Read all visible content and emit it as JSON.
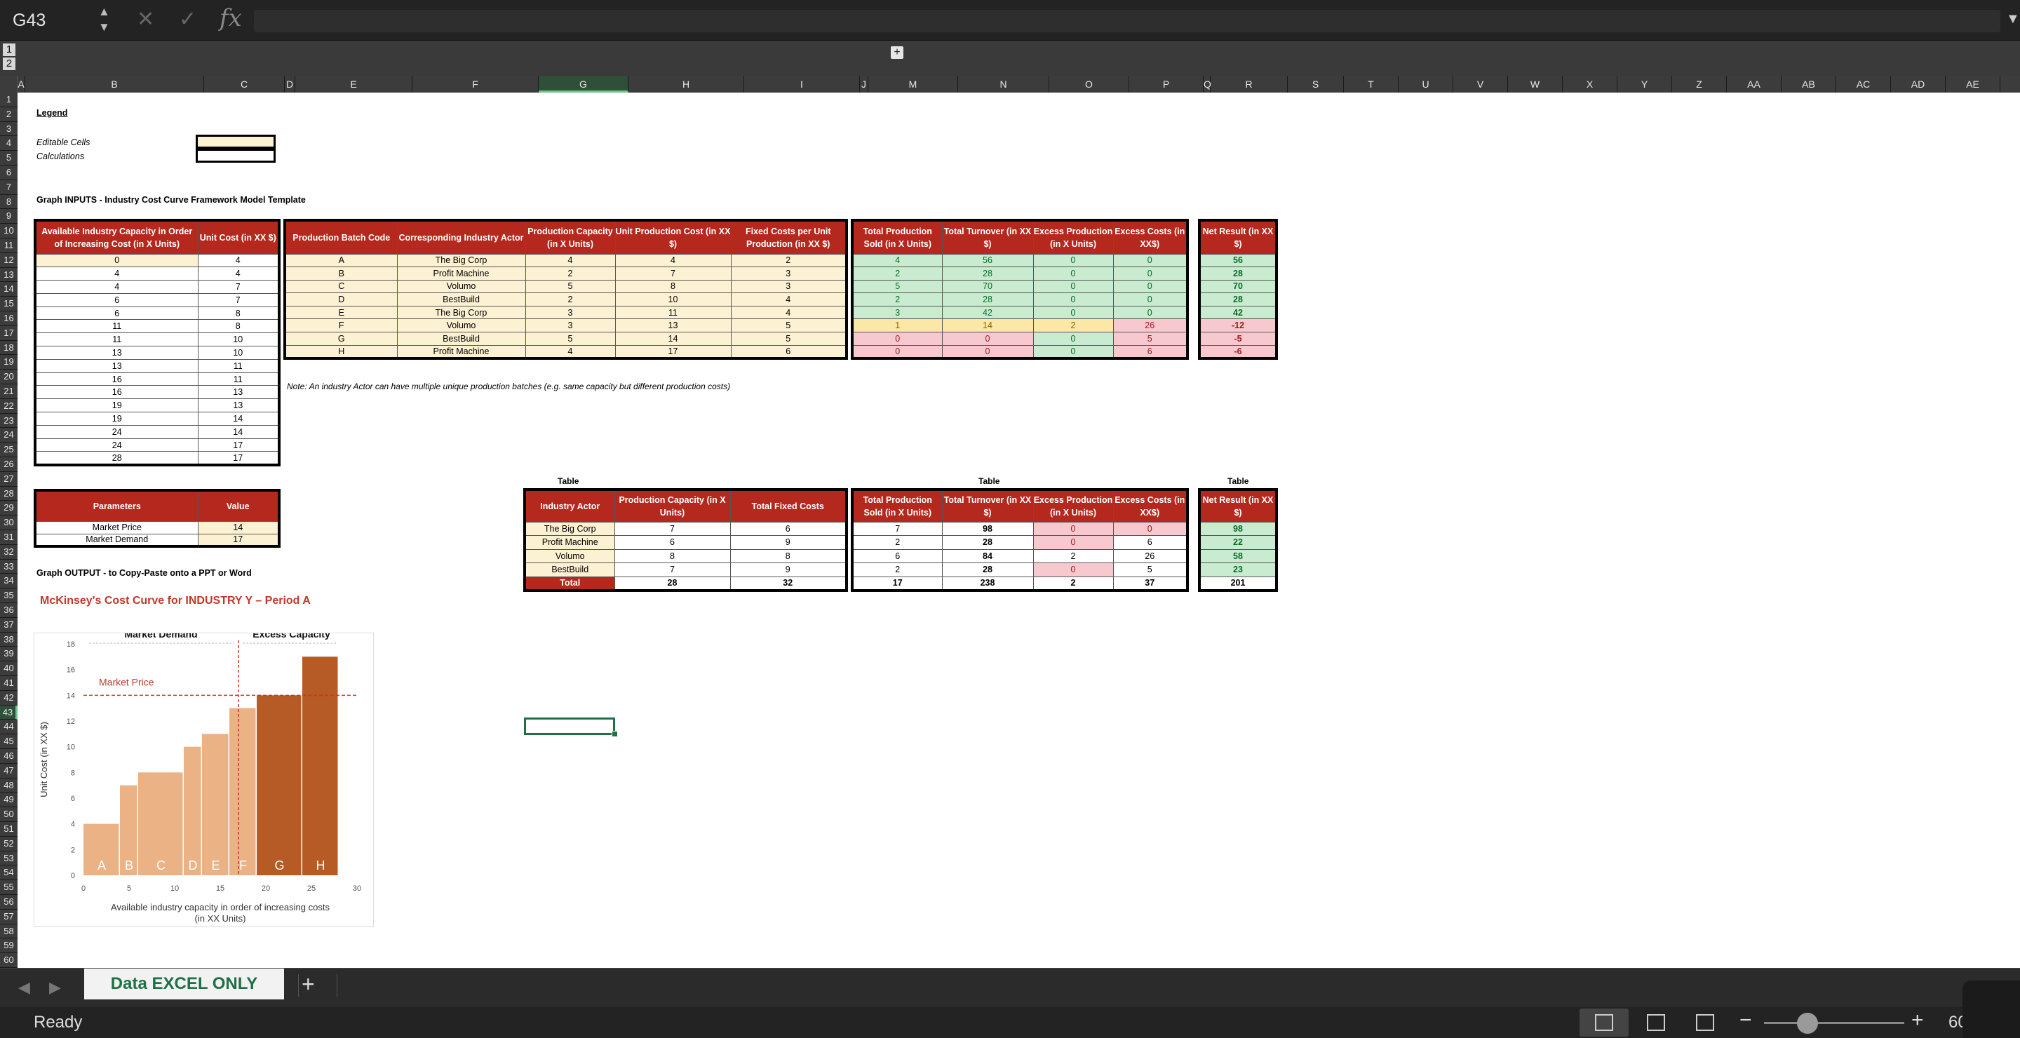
{
  "formula_bar": {
    "cell_ref": "G43",
    "fx_symbol": "fx",
    "cancel_symbol": "✕",
    "enter_symbol": "✓"
  },
  "outline": {
    "levels": [
      "1",
      "2"
    ],
    "expand": "+"
  },
  "columns": [
    {
      "id": "A"
    },
    {
      "id": "B"
    },
    {
      "id": "C"
    },
    {
      "id": "D"
    },
    {
      "id": "E"
    },
    {
      "id": "F"
    },
    {
      "id": "G"
    },
    {
      "id": "H"
    },
    {
      "id": "I"
    },
    {
      "id": "J"
    },
    {
      "id": "M"
    },
    {
      "id": "N"
    },
    {
      "id": "O"
    },
    {
      "id": "P"
    },
    {
      "id": "Q"
    },
    {
      "id": "R"
    },
    {
      "id": "S"
    },
    {
      "id": "T"
    },
    {
      "id": "U"
    },
    {
      "id": "V"
    },
    {
      "id": "W"
    },
    {
      "id": "X"
    },
    {
      "id": "Y"
    },
    {
      "id": "Z"
    },
    {
      "id": "AA"
    },
    {
      "id": "AB"
    },
    {
      "id": "AC"
    },
    {
      "id": "AD"
    },
    {
      "id": "AE"
    },
    {
      "id": "AF"
    }
  ],
  "rows_count": 60,
  "selected_row": 43,
  "selected_col": "G",
  "legend": {
    "title": "Legend",
    "editable": "Editable Cells",
    "calculations": "Calculations"
  },
  "inputs_title": "Graph INPUTS - Industry Cost Curve Framework Model Template",
  "capacity_table": {
    "headers": [
      "Available Industry Capacity in Order of Increasing Cost (in X Units)",
      "Unit Cost (in XX $)"
    ],
    "rows": [
      [
        "0",
        "4"
      ],
      [
        "4",
        "4"
      ],
      [
        "4",
        "7"
      ],
      [
        "6",
        "7"
      ],
      [
        "6",
        "8"
      ],
      [
        "11",
        "8"
      ],
      [
        "11",
        "10"
      ],
      [
        "13",
        "10"
      ],
      [
        "13",
        "11"
      ],
      [
        "16",
        "11"
      ],
      [
        "16",
        "13"
      ],
      [
        "19",
        "13"
      ],
      [
        "19",
        "14"
      ],
      [
        "24",
        "14"
      ],
      [
        "24",
        "17"
      ],
      [
        "28",
        "17"
      ]
    ]
  },
  "batch_table": {
    "headers": [
      "Production Batch Code",
      "Corresponding Industry Actor",
      "Production Capacity (in X Units)",
      "Unit Production Cost (in XX $)",
      "Fixed Costs per Unit Production (in XX $)"
    ],
    "rows": [
      [
        "A",
        "The Big Corp",
        "4",
        "4",
        "2"
      ],
      [
        "B",
        "Profit Machine",
        "2",
        "7",
        "3"
      ],
      [
        "C",
        "Volumo",
        "5",
        "8",
        "3"
      ],
      [
        "D",
        "BestBuild",
        "2",
        "10",
        "4"
      ],
      [
        "E",
        "The Big Corp",
        "3",
        "11",
        "4"
      ],
      [
        "F",
        "Volumo",
        "3",
        "13",
        "5"
      ],
      [
        "G",
        "BestBuild",
        "5",
        "14",
        "5"
      ],
      [
        "H",
        "Profit Machine",
        "4",
        "17",
        "6"
      ]
    ]
  },
  "results_table": {
    "headers": [
      "Total Production Sold (in X Units)",
      "Total Turnover (in XX $)",
      "Excess Production (in X Units)",
      "Excess Costs (in XX$)"
    ],
    "rows": [
      [
        "4",
        "56",
        "0",
        "0"
      ],
      [
        "2",
        "28",
        "0",
        "0"
      ],
      [
        "5",
        "70",
        "0",
        "0"
      ],
      [
        "2",
        "28",
        "0",
        "0"
      ],
      [
        "3",
        "42",
        "0",
        "0"
      ],
      [
        "1",
        "14",
        "2",
        "26"
      ],
      [
        "0",
        "0",
        "0",
        "5"
      ],
      [
        "0",
        "0",
        "0",
        "6"
      ]
    ]
  },
  "net_table": {
    "headers": [
      "Net Result (in XX $)"
    ],
    "rows": [
      [
        "56"
      ],
      [
        "28"
      ],
      [
        "70"
      ],
      [
        "28"
      ],
      [
        "42"
      ],
      [
        "-12"
      ],
      [
        "-5"
      ],
      [
        "-6"
      ]
    ]
  },
  "note": "Note: An industry Actor can have multiple unique production batches (e.g. same capacity but different production costs)",
  "params_table": {
    "headers": [
      "Parameters",
      "Value"
    ],
    "rows": [
      [
        "Market Price",
        "14"
      ],
      [
        "Market Demand",
        "17"
      ]
    ]
  },
  "summary_labels": {
    "left": "Table",
    "middle": "Table",
    "right": "Table"
  },
  "actor_table": {
    "headers": [
      "Industry Actor",
      "Production Capacity (in X Units)",
      "Total Fixed Costs"
    ],
    "rows": [
      [
        "The Big Corp",
        "7",
        "6"
      ],
      [
        "Profit Machine",
        "6",
        "9"
      ],
      [
        "Volumo",
        "8",
        "8"
      ],
      [
        "BestBuild",
        "7",
        "9"
      ]
    ],
    "total": [
      "Total",
      "28",
      "32"
    ]
  },
  "actor_results_table": {
    "headers": [
      "Total Production Sold (in X Units)",
      "Total Turnover (in XX $)",
      "Excess Production (in X Units)",
      "Excess Costs (in XX$)"
    ],
    "rows": [
      [
        "7",
        "98",
        "0",
        "0"
      ],
      [
        "2",
        "28",
        "0",
        "6"
      ],
      [
        "6",
        "84",
        "2",
        "26"
      ],
      [
        "2",
        "28",
        "0",
        "5"
      ]
    ],
    "total": [
      "17",
      "238",
      "2",
      "37"
    ]
  },
  "actor_net_table": {
    "headers": [
      "Net Result (in XX $)"
    ],
    "rows": [
      [
        "98"
      ],
      [
        "22"
      ],
      [
        "58"
      ],
      [
        "23"
      ]
    ],
    "total": [
      "201"
    ]
  },
  "output_title": "Graph OUTPUT - to Copy-Paste onto a PPT or Word",
  "chart_heading": "McKinsey's Cost Curve for INDUSTRY Y – Period A",
  "chart_data": {
    "type": "bar",
    "title": "",
    "xlabel": "Available industry capacity in order of increasing costs (in XX Units)",
    "ylabel": "Unit Cost (in XX $)",
    "xlim": [
      0,
      30
    ],
    "ylim": [
      0,
      18
    ],
    "x_ticks": [
      0,
      5,
      10,
      15,
      20,
      25,
      30
    ],
    "y_ticks": [
      0,
      2,
      4,
      6,
      8,
      10,
      12,
      14,
      16,
      18
    ],
    "bars": [
      {
        "label": "A",
        "start": 0,
        "width": 4,
        "value": 4
      },
      {
        "label": "B",
        "start": 4,
        "width": 2,
        "value": 7
      },
      {
        "label": "C",
        "start": 6,
        "width": 5,
        "value": 8
      },
      {
        "label": "D",
        "start": 11,
        "width": 2,
        "value": 10
      },
      {
        "label": "E",
        "start": 13,
        "width": 3,
        "value": 11
      },
      {
        "label": "F",
        "start": 16,
        "width": 3,
        "value": 13
      },
      {
        "label": "G",
        "start": 19,
        "width": 5,
        "value": 14
      },
      {
        "label": "H",
        "start": 24,
        "width": 4,
        "value": 17
      }
    ],
    "market_price": 14,
    "market_demand": 17,
    "market_price_label": "Market Price",
    "market_demand_label": "Market Demand",
    "excess_capacity_label": "Excess Capacity",
    "colors": {
      "bar": "#ebb286",
      "bar_excess": "#b65a26",
      "price_line": "#c0392b"
    }
  },
  "sheet_tab": "Data EXCEL ONLY",
  "add_sheet": "+",
  "status": "Ready",
  "zoom_minus": "−",
  "zoom_plus": "+",
  "zoom_level": "60"
}
